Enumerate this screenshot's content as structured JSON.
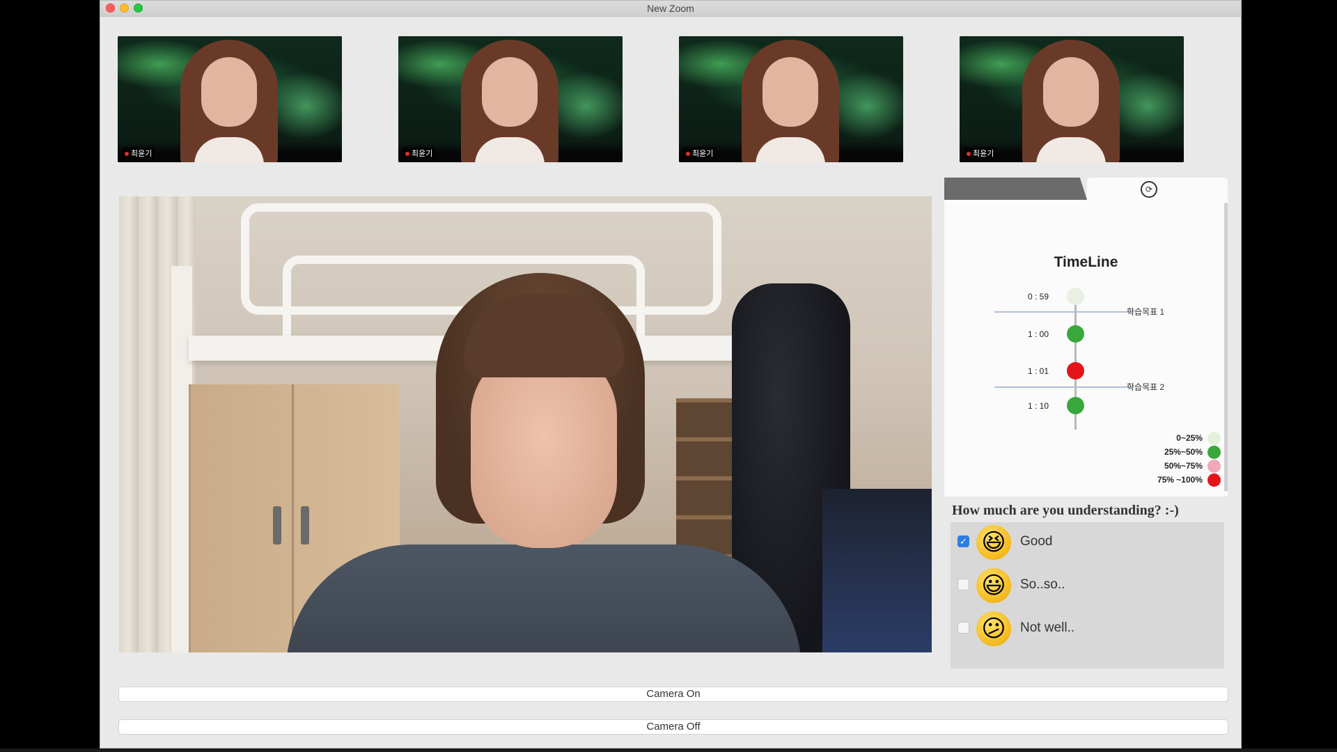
{
  "window": {
    "title": "New Zoom"
  },
  "thumbnails": [
    {
      "name": "최윤기"
    },
    {
      "name": "최윤기"
    },
    {
      "name": "최윤기"
    },
    {
      "name": "최윤기"
    }
  ],
  "timeline": {
    "title": "TimeLine",
    "entries": [
      {
        "time": "0 : 59",
        "color": "#e9efe3"
      },
      {
        "time": "1 : 00",
        "color": "#38a83c"
      },
      {
        "time": "1 : 01",
        "color": "#e4141a"
      },
      {
        "time": "1 : 10",
        "color": "#38a83c"
      }
    ],
    "markers": [
      {
        "label": "학습목표 1"
      },
      {
        "label": "학습목표 2"
      }
    ],
    "legend": [
      {
        "label": "0~25%",
        "color": "#e3f1dc"
      },
      {
        "label": "25%~50%",
        "color": "#38a83c"
      },
      {
        "label": "50%~75%",
        "color": "#f0a9b5"
      },
      {
        "label": "75% ~100%",
        "color": "#e4141a"
      }
    ]
  },
  "survey": {
    "question": "How much are you understanding? :-)",
    "options": [
      {
        "label": "Good",
        "checked": true,
        "emoji": "😆"
      },
      {
        "label": "So..so..",
        "checked": false,
        "emoji": "😃"
      },
      {
        "label": "Not well..",
        "checked": false,
        "emoji": "😕"
      }
    ]
  },
  "controls": {
    "camera_on": "Camera On",
    "camera_off": "Camera Off"
  },
  "icons": {
    "refresh": "refresh-icon"
  }
}
